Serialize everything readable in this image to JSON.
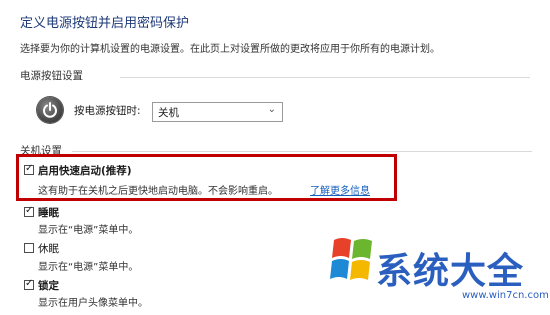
{
  "page_title": "定义电源按钮并启用密码保护",
  "description": "选择要为你的计算机设置的电源设置。在此页上对设置所做的更改将应用于你所有的电源计划。",
  "power_button_section": {
    "heading": "电源按钮设置",
    "label": "按电源按钮时:",
    "selected": "关机"
  },
  "shutdown_section": {
    "heading": "关机设置",
    "options": [
      {
        "label": "启用快速启动(推荐)",
        "checked": true,
        "desc": "这有助于在关机之后更快地启动电脑。不会影响重启。",
        "link": "了解更多信息"
      },
      {
        "label": "睡眠",
        "checked": true,
        "desc": "显示在“电源”菜单中。"
      },
      {
        "label": "休眠",
        "checked": false,
        "desc": "显示在“电源”菜单中。"
      },
      {
        "label": "锁定",
        "checked": true,
        "desc": "显示在用户头像菜单中。"
      }
    ]
  },
  "watermark": {
    "brand": "系统大全",
    "url": "www.win7cn.com"
  },
  "colors": {
    "highlight_border": "#c00000",
    "title": "#1e3a78",
    "link": "#1560bd",
    "watermark": "#2a5fbf"
  },
  "icons": {
    "power": "power-icon",
    "dropdown": "chevron-down-icon",
    "check": "checkmark-icon",
    "logo": "windows-logo-icon"
  }
}
